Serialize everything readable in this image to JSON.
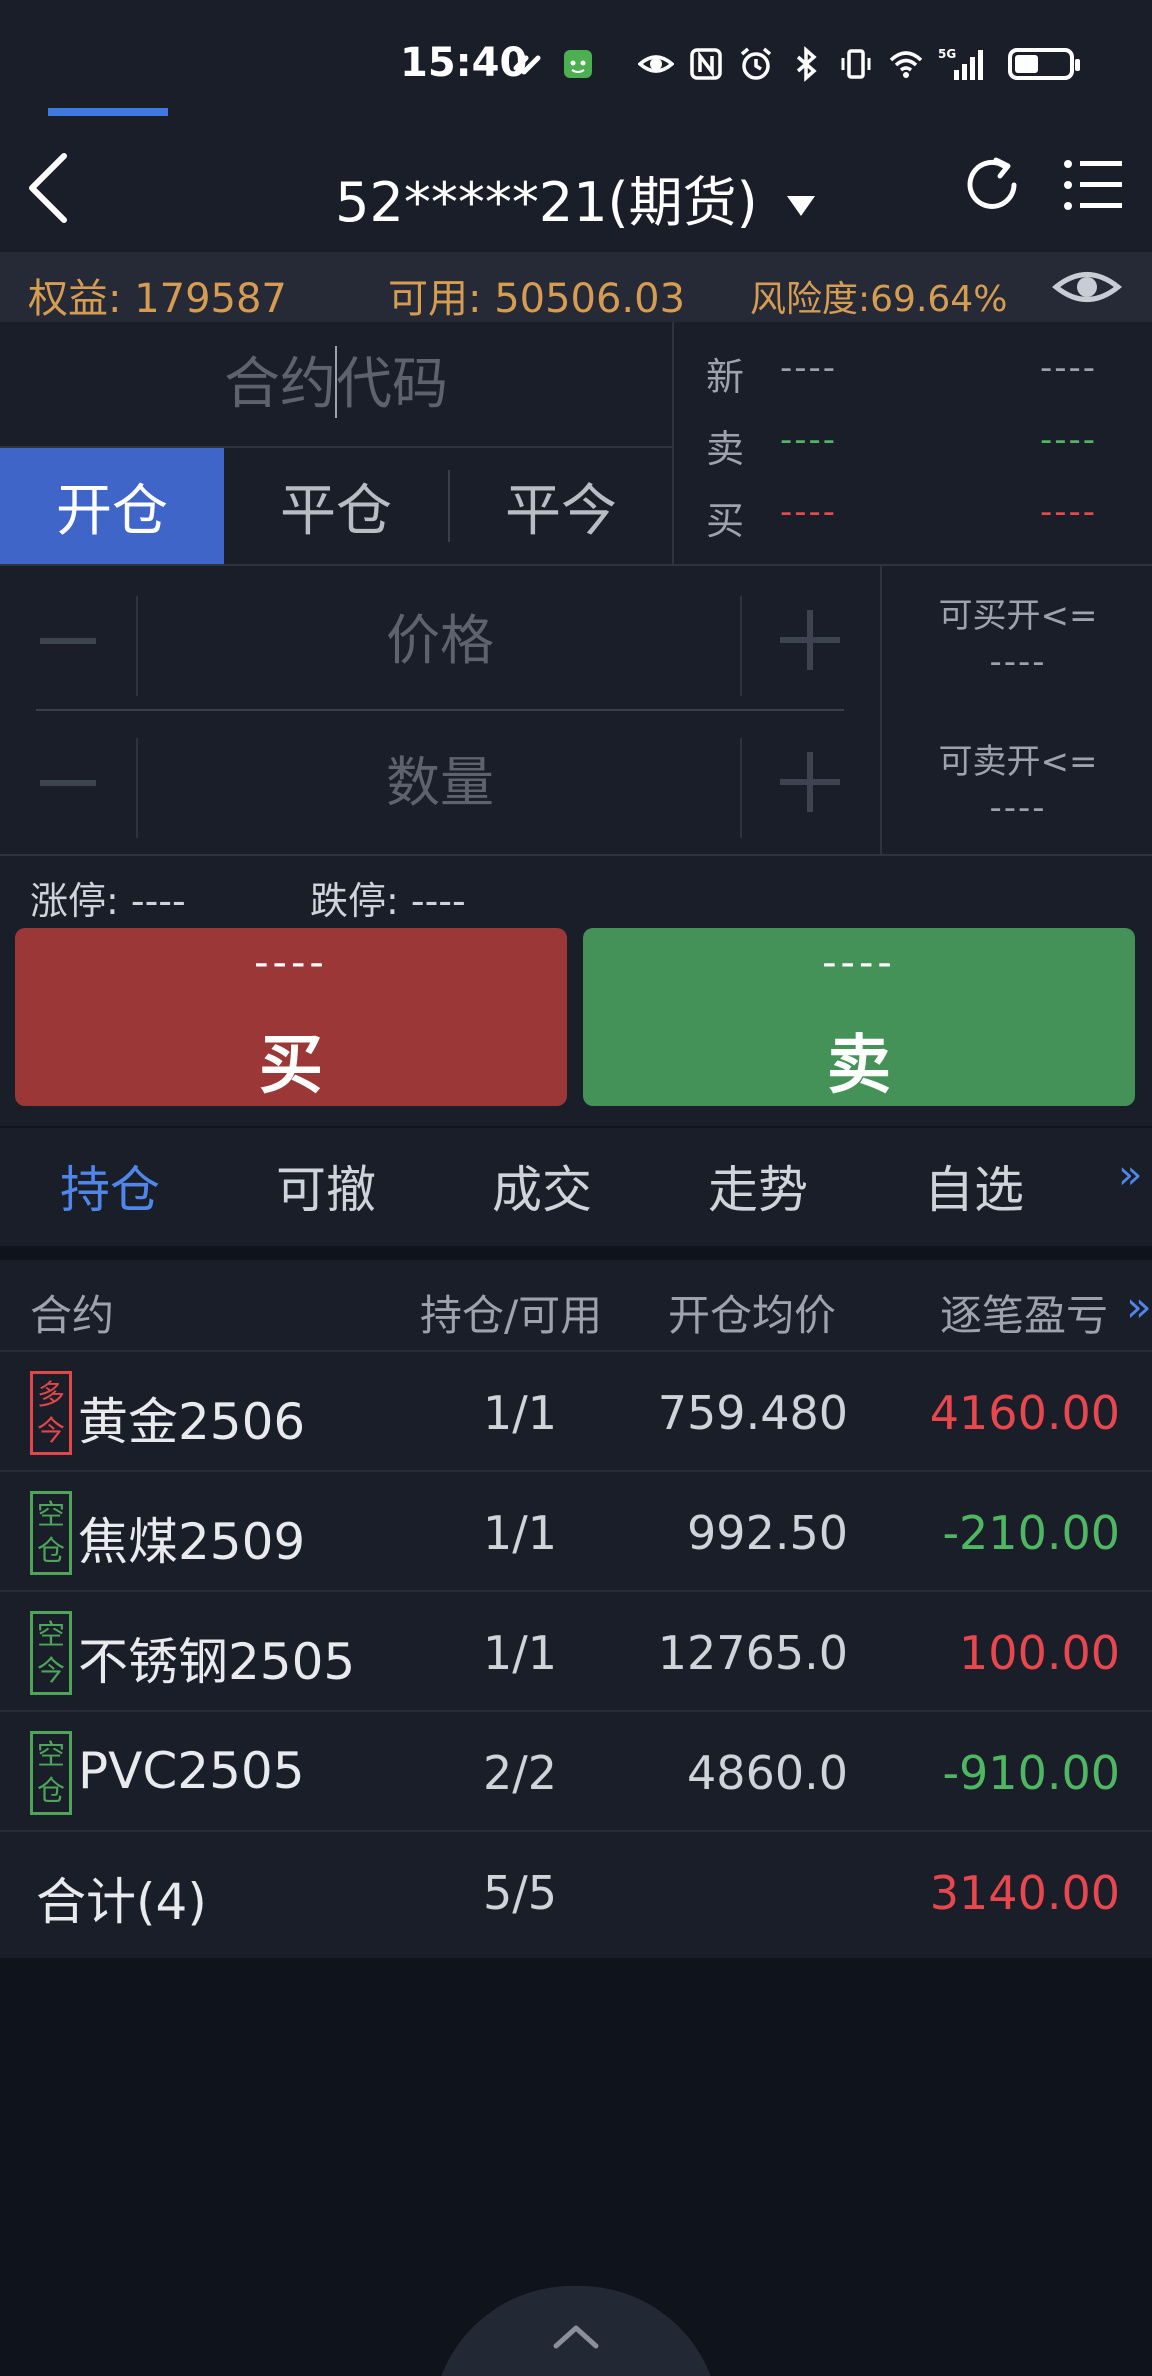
{
  "status_bar": {
    "time": "15:40",
    "icons": [
      "link-icon",
      "cat-icon",
      "eye-icon",
      "nfc-icon",
      "alarm-icon",
      "bluetooth-icon",
      "vibrate-icon",
      "wifi-icon",
      "5g-signal-icon",
      "battery-icon"
    ],
    "battery_level": 0.45
  },
  "header": {
    "title": "52*****21(期货)",
    "dropdown_icon": "caret-down-icon",
    "back_icon": "chevron-left-icon",
    "refresh_icon": "refresh-icon",
    "menu_icon": "menu-icon"
  },
  "info": {
    "equity": "权益: 179587",
    "available": "可用: 50506.03",
    "risk": "风险度:69.64%",
    "eye_icon": "eye-icon"
  },
  "order": {
    "code_placeholder": "合约代码",
    "tabs": [
      "开仓",
      "平仓",
      "平今"
    ],
    "active_tab": 0,
    "quote_labels": [
      "新",
      "卖",
      "买"
    ],
    "quote_values": [
      "----",
      "----",
      "----"
    ],
    "price_placeholder": "价格",
    "qty_placeholder": "数量",
    "max_buy_label": "可买开<=",
    "max_buy_value": "----",
    "max_sell_label": "可卖开<=",
    "max_sell_value": "----",
    "limit_up": "涨停: ----",
    "limit_down": "跌停: ----",
    "buy_price": "----",
    "buy_label": "买",
    "sell_price": "----",
    "sell_label": "卖"
  },
  "bottom_tabs": {
    "items": [
      "持仓",
      "可撤",
      "成交",
      "走势",
      "自选"
    ],
    "active": 0,
    "more_icon": "double-chevron-right-icon"
  },
  "positions": {
    "headers": [
      "合约",
      "持仓/可用",
      "开仓均价",
      "逐笔盈亏"
    ],
    "more_icon": "double-chevron-right-icon",
    "rows": [
      {
        "badge": "多今",
        "badge_color": "#e0464a",
        "name": "黄金2506",
        "hold": "1/1",
        "avg": "759.480",
        "pnl": "4160.00"
      },
      {
        "badge": "空仓",
        "badge_color": "#4ea55a",
        "name": "焦煤2509",
        "hold": "1/1",
        "avg": "992.50",
        "pnl": "-210.00"
      },
      {
        "badge": "空今",
        "badge_color": "#4ea55a",
        "name": "不锈钢2505",
        "hold": "1/1",
        "avg": "12765.0",
        "pnl": "100.00"
      },
      {
        "badge": "空仓",
        "badge_color": "#4ea55a",
        "name": "PVC2505",
        "hold": "2/2",
        "avg": "4860.0",
        "pnl": "-910.00"
      }
    ],
    "total": {
      "label": "合计(4)",
      "hold": "5/5",
      "pnl": "3140.00"
    }
  },
  "colors": {
    "background": "#0f131c",
    "panel": "#1a1e29",
    "accent_blue": "#3f65c9",
    "gain_red": "#e8474d",
    "loss_green": "#4fb762",
    "info_orange": "#d69c52",
    "buy_button": "#9b3736",
    "sell_button": "#449257"
  },
  "bottom_handle_icon": "chevron-up-icon"
}
